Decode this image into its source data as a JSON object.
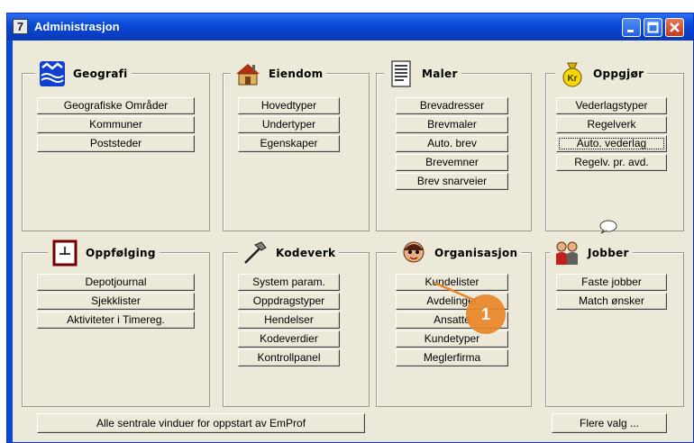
{
  "window": {
    "app_icon_text": "7",
    "title": "Administrasjon"
  },
  "groups": {
    "geografi": {
      "label": "Geografi",
      "icon": "flag-icon",
      "buttons": [
        "Geografiske Områder",
        "Kommuner",
        "Poststeder"
      ]
    },
    "eiendom": {
      "label": "Eiendom",
      "icon": "house-icon",
      "buttons": [
        "Hovedtyper",
        "Undertyper",
        "Egenskaper"
      ]
    },
    "maler": {
      "label": "Maler",
      "icon": "document-icon",
      "buttons": [
        "Brevadresser",
        "Brevmaler",
        "Auto. brev",
        "Brevemner",
        "Brev snarveier"
      ]
    },
    "oppgjor": {
      "label": "Oppgjør",
      "icon": "money-bag-icon",
      "icon_text": "Kr",
      "buttons": [
        "Vederlagstyper",
        "Regelverk",
        "Auto. vederlag",
        "Regelv. pr. avd."
      ]
    },
    "oppfolging": {
      "label": "Oppfølging",
      "icon": "clock-icon",
      "buttons": [
        "Depotjournal",
        "Sjekklister",
        "Aktiviteter i Timereg."
      ]
    },
    "kodeverk": {
      "label": "Kodeverk",
      "icon": "hammer-icon",
      "buttons": [
        "System param.",
        "Oppdragstyper",
        "Hendelser",
        "Kodeverdier",
        "Kontrollpanel"
      ]
    },
    "organisasjon": {
      "label": "Organisasjon",
      "icon": "person-icon",
      "buttons": [
        "Kundelister",
        "Avdelinger",
        "Ansatte",
        "Kundetyper",
        "Meglerfirma"
      ]
    },
    "jobber": {
      "label": "Jobber",
      "icon": "people-icon",
      "buttons": [
        "Faste jobber",
        "Match ønsker"
      ]
    }
  },
  "footer": {
    "all_windows": "Alle sentrale vinduer for oppstart av EmProf",
    "more_choices": "Flere valg ..."
  },
  "annotation": {
    "badge": "1",
    "color": "#e88428"
  }
}
